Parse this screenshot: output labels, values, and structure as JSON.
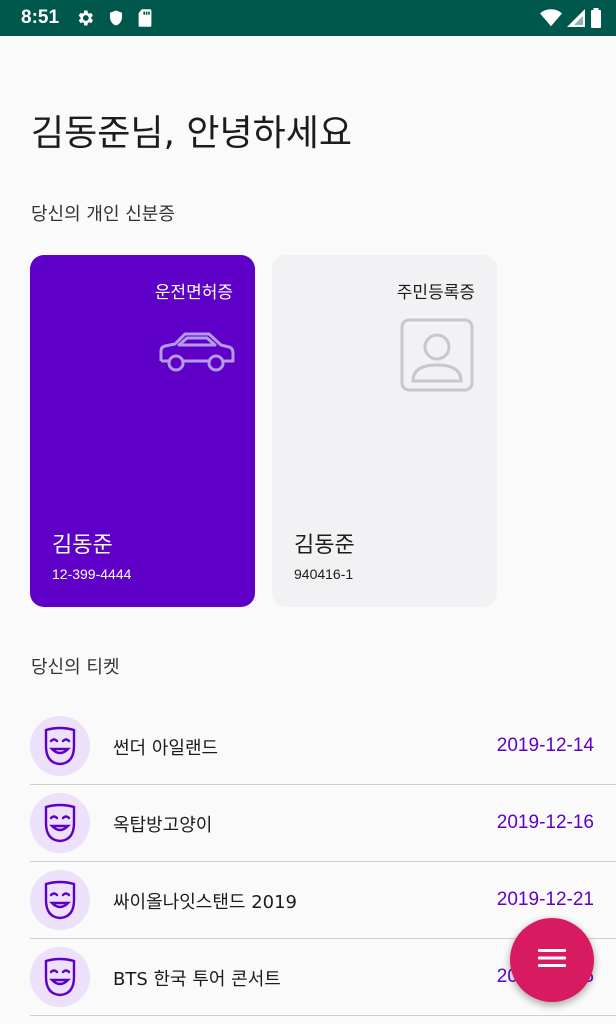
{
  "status_bar": {
    "time": "8:51",
    "left_icons": [
      "gear-icon",
      "shield-icon",
      "sd-card-icon"
    ],
    "right_icons": [
      "wifi-icon",
      "signal-icon",
      "battery-icon"
    ],
    "background": "#00574b"
  },
  "greeting": "김동준님, 안녕하세요",
  "id_section": {
    "title": "당신의 개인 신분증",
    "cards": [
      {
        "type": "운전면허증",
        "icon": "car-icon",
        "name": "김동준",
        "number": "12-399-4444",
        "background": "#5e00c8"
      },
      {
        "type": "주민등록증",
        "icon": "person-portrait-icon",
        "name": "김동준",
        "number": "940416-1",
        "background": "#f2f2f4"
      }
    ]
  },
  "ticket_section": {
    "title": "당신의 티켓",
    "tickets": [
      {
        "icon": "theater-mask-icon",
        "title": "썬더 아일랜드",
        "date": "2019-12-14"
      },
      {
        "icon": "theater-mask-icon",
        "title": "옥탑방고양이",
        "date": "2019-12-16"
      },
      {
        "icon": "theater-mask-icon",
        "title": "싸이올나잇스탠드 2019",
        "date": "2019-12-21"
      },
      {
        "icon": "theater-mask-icon",
        "title": "BTS 한국 투어 콘서트",
        "date": "2019-12-25"
      }
    ]
  },
  "fab": {
    "icon": "menu-icon",
    "color": "#d81b60"
  },
  "colors": {
    "accent": "#5e00c8",
    "ticket_avatar_bg": "#ece0fb"
  }
}
